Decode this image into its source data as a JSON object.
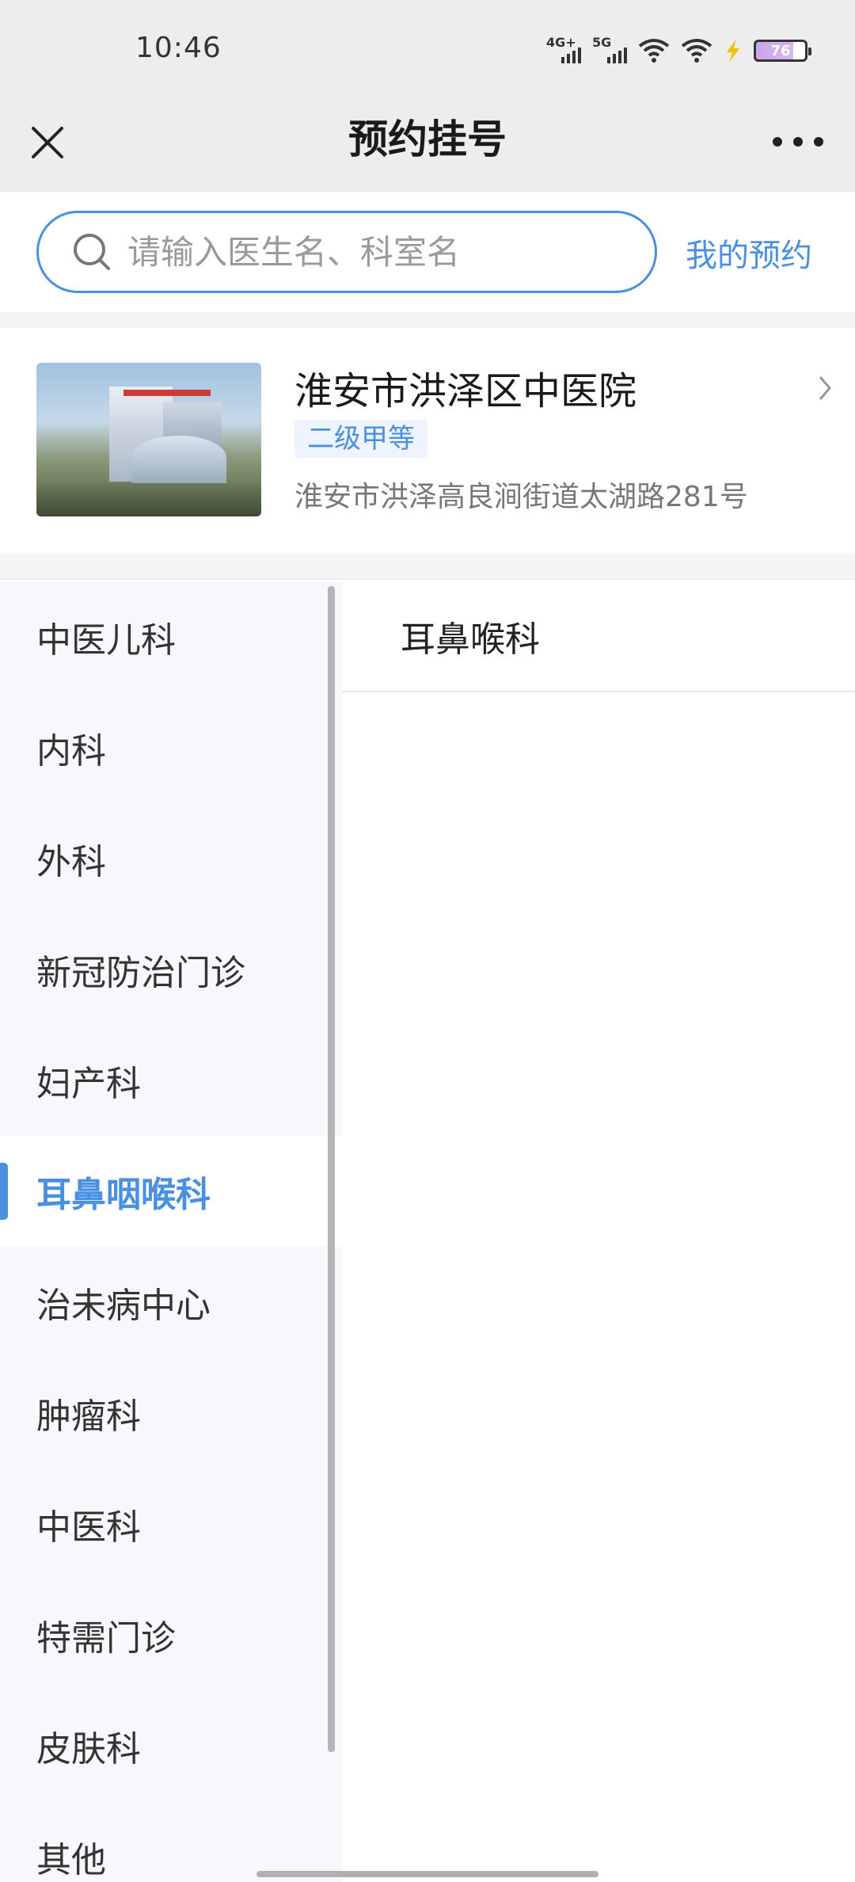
{
  "status_bar": {
    "time": "10:46",
    "signal1_label": "4G+",
    "signal2_label": "5G",
    "battery": "76"
  },
  "header": {
    "title": "预约挂号",
    "close_icon": "close-icon",
    "more_icon": "more-icon"
  },
  "search": {
    "placeholder": "请输入医生名、科室名",
    "my_appointments": "我的预约"
  },
  "hospital": {
    "name": "淮安市洪泽区中医院",
    "level": "二级甲等",
    "address": "淮安市洪泽高良涧街道太湖路281号"
  },
  "departments": [
    {
      "label": "中医儿科"
    },
    {
      "label": "内科"
    },
    {
      "label": "外科"
    },
    {
      "label": "新冠防治门诊"
    },
    {
      "label": "妇产科"
    },
    {
      "label": "耳鼻咽喉科",
      "active": true
    },
    {
      "label": "治未病中心"
    },
    {
      "label": "肿瘤科"
    },
    {
      "label": "中医科"
    },
    {
      "label": "特需门诊"
    },
    {
      "label": "皮肤科"
    },
    {
      "label": "其他"
    }
  ],
  "sub_departments": [
    {
      "label": "耳鼻喉科"
    }
  ],
  "colors": {
    "accent": "#4a90e2",
    "header_bg": "#ededed",
    "list_bg": "#f7f8fc"
  }
}
